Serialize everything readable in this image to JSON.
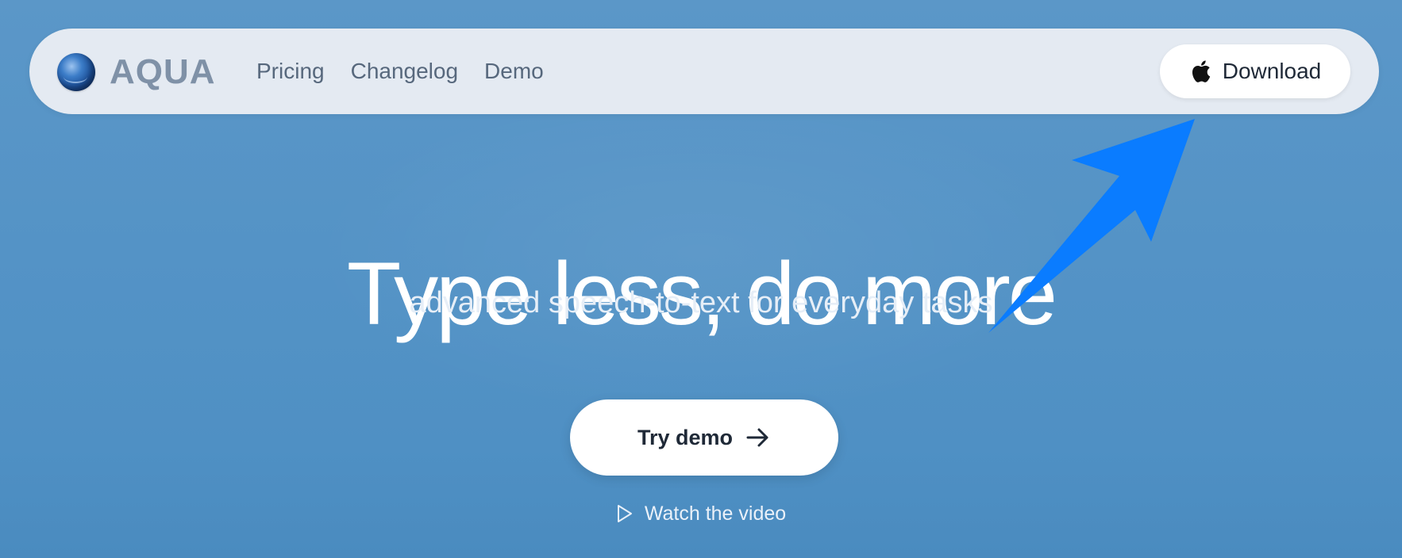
{
  "nav": {
    "brand": "AQUA",
    "links": [
      "Pricing",
      "Changelog",
      "Demo"
    ],
    "download_label": "Download"
  },
  "hero": {
    "title": "Type less, do more",
    "subtitle": "advanced speech-to-text for everyday tasks",
    "try_demo_label": "Try demo",
    "watch_video_label": "Watch the video"
  },
  "icons": {
    "logo": "orb-logo-icon",
    "download": "apple-icon",
    "try_demo": "arrow-right-icon",
    "watch_video": "play-icon",
    "annotation": "annotation-arrow-icon"
  },
  "colors": {
    "background": "#5493c6",
    "navbar": "#e4eaf2",
    "button": "#ffffff",
    "annotation_arrow": "#0a7cff",
    "brand_text": "#7f91a7"
  }
}
